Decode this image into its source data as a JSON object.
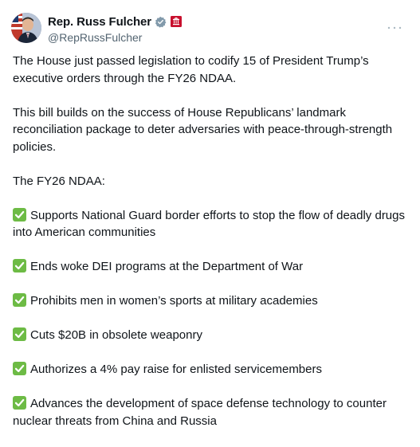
{
  "author": {
    "display_name": "Rep. Russ Fulcher",
    "handle": "@RepRussFulcher",
    "verified_icon": "verified-badge-icon",
    "affiliation_icon": "us-house-badge-icon"
  },
  "tweet": {
    "paragraphs": [
      "The House just passed legislation to codify 15 of President Trump’s executive orders through the FY26 NDAA.",
      "This bill builds on the success of House Republicans’ landmark reconciliation package to deter adversaries with peace-through-strength policies.",
      "The FY26 NDAA:"
    ],
    "items": [
      "Supports National Guard border efforts to stop the flow of deadly drugs into American communities",
      "Ends woke DEI programs at the Department of War",
      "Prohibits men in women’s sports at military academies",
      "Cuts $20B in obsolete weaponry",
      "Authorizes a 4% pay raise for enlisted servicemembers",
      "Advances the development of space defense technology to counter nuclear threats from China and Russia"
    ]
  },
  "colors": {
    "text": "#0f1419",
    "muted": "#536471",
    "verified": "#829aab",
    "affiliation": "#c8102e",
    "check": "#6dbb45"
  }
}
